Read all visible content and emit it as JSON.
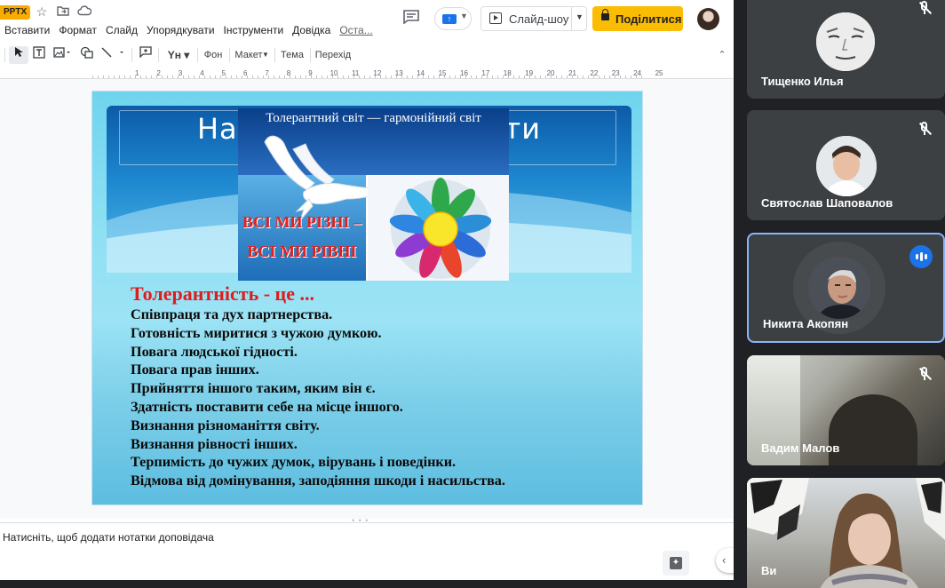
{
  "editor": {
    "file_badge": "PPTX",
    "menu": [
      "Вставити",
      "Формат",
      "Слайд",
      "Упорядкувати",
      "Інструменти",
      "Довідка"
    ],
    "last_edit": "Оста...",
    "slideshow_label": "Слайд-шоу",
    "share_label": "Поділитися",
    "toolbar": {
      "background_label": "Фон",
      "layout_label": "Макет",
      "theme_label": "Тема",
      "transition_label": "Перехід"
    },
    "ruler_numbers": [
      "1",
      "2",
      "3",
      "4",
      "5",
      "6",
      "7",
      "8",
      "9",
      "10",
      "11",
      "12",
      "13",
      "14",
      "15",
      "16",
      "17",
      "18",
      "19",
      "20",
      "21",
      "22",
      "23",
      "24",
      "25"
    ],
    "notes_placeholder": "Натисніть, щоб додати нотатки доповідача"
  },
  "slide": {
    "title_left": "На",
    "title_right": "ти",
    "poster_caption": "Толерантний світ — гармонійний світ",
    "poster_slogan_1": "ВСІ МИ РІЗНІ –",
    "poster_slogan_2": "ВСІ МИ РІВНІ",
    "heading": "Толерантність - це ...",
    "lines": [
      "Співпраця та дух партнерства.",
      "Готовність миритися з чужою думкою.",
      "Повага людської гідності.",
      "Повага прав інших.",
      "Прийняття іншого таким, яким він є.",
      "Здатність поставити себе на місце іншого.",
      "Визнання різноманіття світу.",
      "Визнання рівності інших.",
      "Терпимість до чужих думок, вірувань і поведінки.",
      "Відмова від домінування, заподіяння шкоди і насильства."
    ]
  },
  "participants": [
    {
      "name": "Тищенко Илья",
      "muted": true,
      "speaking": false
    },
    {
      "name": "Святослав Шаповалов",
      "muted": true,
      "speaking": false
    },
    {
      "name": "Никита Акопян",
      "muted": false,
      "speaking": true
    },
    {
      "name": "Вадим Малов",
      "muted": true,
      "speaking": false
    },
    {
      "name": "Ви",
      "muted": false,
      "speaking": false
    }
  ],
  "colors": {
    "share_button": "#fbbc04",
    "meet_background": "#202124",
    "speaking_indicator": "#1a73e8",
    "slide_heading": "#e01b1b"
  }
}
